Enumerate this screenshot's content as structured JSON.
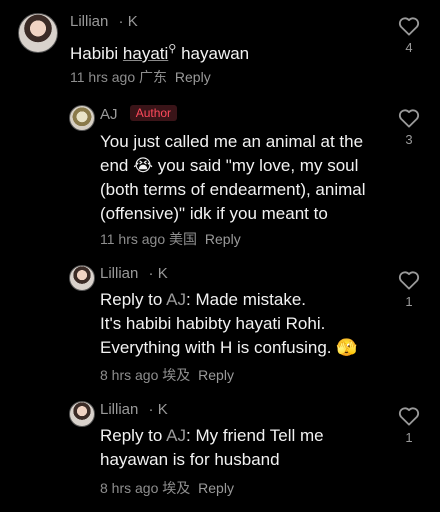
{
  "comments": [
    {
      "author": "Lillian",
      "suffix": "· K",
      "text_prefix": "Habibi ",
      "text_link": "hayati",
      "text_suffix": " hayawan",
      "time": "11 hrs ago",
      "location": "广东",
      "reply_label": "Reply",
      "likes": "4"
    },
    {
      "author": "AJ",
      "badge": "Author",
      "line1": "You just called me an animal at the",
      "line2_a": "end",
      "line2_emoji": "😭",
      "line2_b": "you said \"my love, my soul",
      "line3": "(both terms of endearment), animal",
      "line4": "(offensive)\" idk if you meant to",
      "time": "11 hrs ago",
      "location": "美国",
      "reply_label": "Reply",
      "likes": "3"
    },
    {
      "author": "Lillian",
      "suffix": "· K",
      "reply_to": "Reply to",
      "reply_target": "AJ",
      "line1": "Made mistake.",
      "line2": "It's habibi habibty hayati Rohi.",
      "line3": "Everything with H is confusing.",
      "emoji": "🫣",
      "time": "8 hrs ago",
      "location": "埃及",
      "reply_label": "Reply",
      "likes": "1"
    },
    {
      "author": "Lillian",
      "suffix": "· K",
      "reply_to": "Reply to",
      "reply_target": "AJ",
      "line1": "My friend Tell me",
      "line2": "hayawan is for husband",
      "time": "8 hrs ago",
      "location": "埃及",
      "reply_label": "Reply",
      "likes": "1"
    }
  ],
  "icons": {
    "like": "heart-outline-icon",
    "search_hint": "search-icon"
  },
  "colors": {
    "background": "#000000",
    "author_badge_text": "#ff4a5c",
    "author_badge_bg": "#3a1418"
  }
}
